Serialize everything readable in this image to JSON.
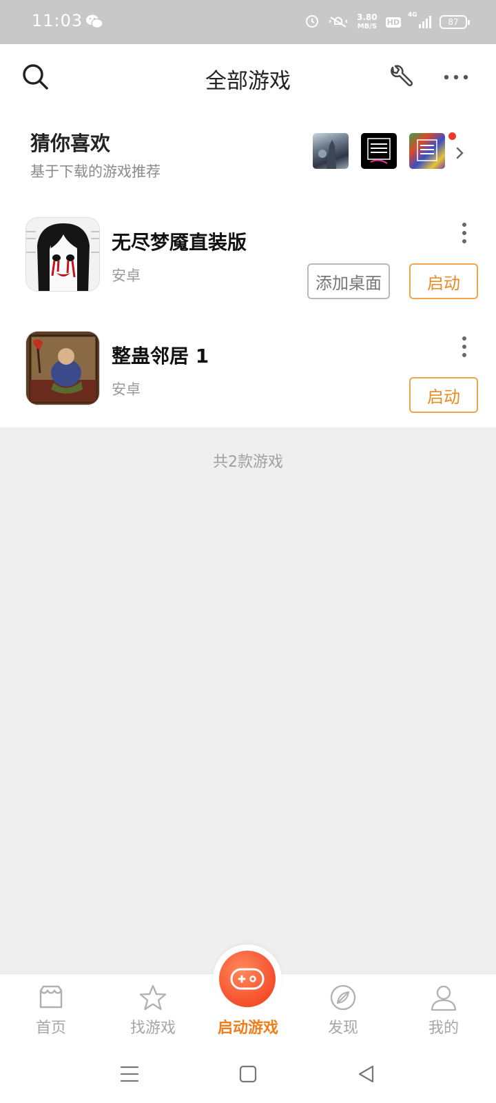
{
  "status_bar": {
    "time": "11:03",
    "net_speed_value": "3.80",
    "net_speed_unit": "MB/S",
    "hd": "HD",
    "network": "4G",
    "battery": "87"
  },
  "header": {
    "title": "全部游戏"
  },
  "recommend": {
    "title": "猜你喜欢",
    "subtitle": "基于下载的游戏推荐"
  },
  "games": [
    {
      "name": "无尽梦魇直装版",
      "platform": "安卓",
      "add_desktop_label": "添加桌面",
      "launch_label": "启动"
    },
    {
      "name": "整蛊邻居 1",
      "platform": "安卓",
      "launch_label": "启动"
    }
  ],
  "total_count": "共2款游戏",
  "bottom_nav": {
    "items": [
      {
        "label": "首页",
        "icon": "shop-icon"
      },
      {
        "label": "找游戏",
        "icon": "star-icon"
      },
      {
        "label": "启动游戏",
        "icon": "gamepad-icon"
      },
      {
        "label": "发现",
        "icon": "compass-icon"
      },
      {
        "label": "我的",
        "icon": "person-icon"
      }
    ],
    "active_index": 2
  },
  "colors": {
    "accent": "#ef7d1a",
    "fab": "#f54e2c",
    "notification_dot": "#e8392b"
  }
}
